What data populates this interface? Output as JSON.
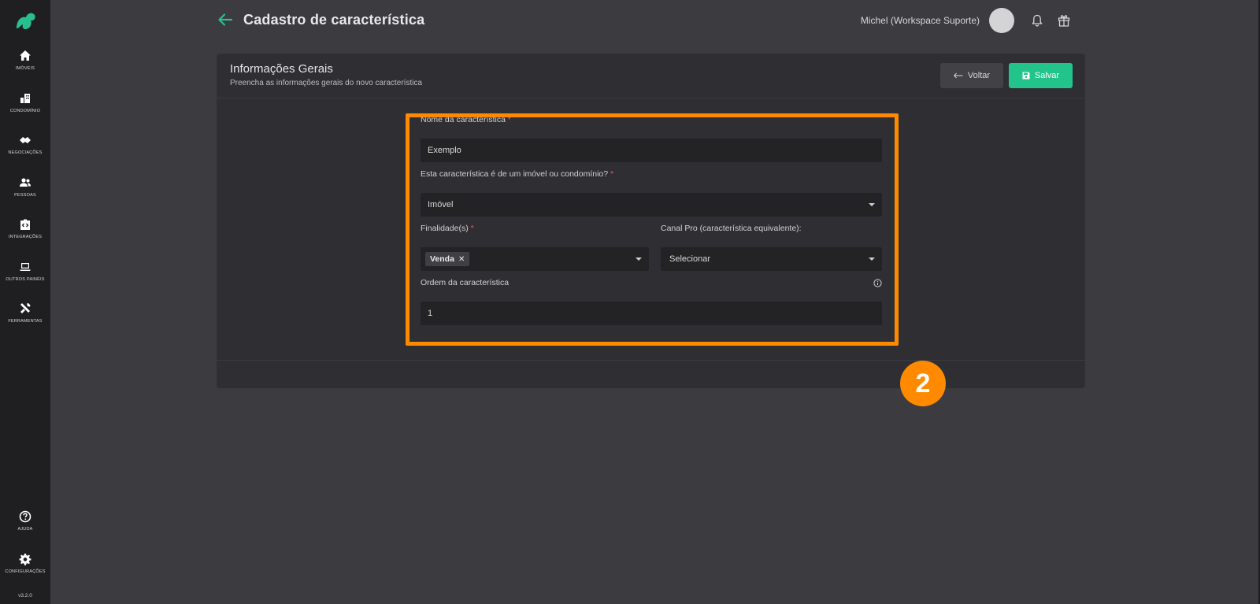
{
  "header": {
    "title": "Cadastro de característica",
    "user_name": "Michel (Workspace Suporte)"
  },
  "sidebar": {
    "items": [
      {
        "label": "IMÓVEIS",
        "icon": "home-icon"
      },
      {
        "label": "CONDOMÍNIO",
        "icon": "building-icon"
      },
      {
        "label": "NEGOCIAÇÕES",
        "icon": "handshake-icon"
      },
      {
        "label": "PESSOAS",
        "icon": "people-icon"
      },
      {
        "label": "INTEGRAÇÕES",
        "icon": "integration-icon"
      },
      {
        "label": "OUTROS PAINÉIS",
        "icon": "laptop-icon"
      },
      {
        "label": "FERRAMENTAS",
        "icon": "tools-icon"
      }
    ],
    "bottom_items": [
      {
        "label": "AJUDA",
        "icon": "help-icon"
      },
      {
        "label": "CONFIGURAÇÕES",
        "icon": "gear-icon"
      }
    ],
    "version": "v3.2.0"
  },
  "card": {
    "title": "Informações Gerais",
    "subtitle": "Preencha as informações gerais do novo característica",
    "back_label": "Voltar",
    "save_label": "Salvar"
  },
  "form": {
    "name_label": "Nome da característica",
    "name_value": "Exemplo",
    "type_label": "Esta característica é de um imóvel ou condomínio?",
    "type_value": "Imóvel",
    "purpose_label": "Finalidade(s)",
    "purpose_chip": "Venda",
    "canal_label": "Canal Pro (característica equivalente):",
    "canal_value": "Selecionar",
    "order_label": "Ordem da característica",
    "order_value": "1",
    "required_mark": "*"
  },
  "annotation": {
    "step_number": "2"
  },
  "colors": {
    "accent": "#22c48c",
    "highlight": "#ff8a00",
    "required": "#ff4d4d"
  }
}
